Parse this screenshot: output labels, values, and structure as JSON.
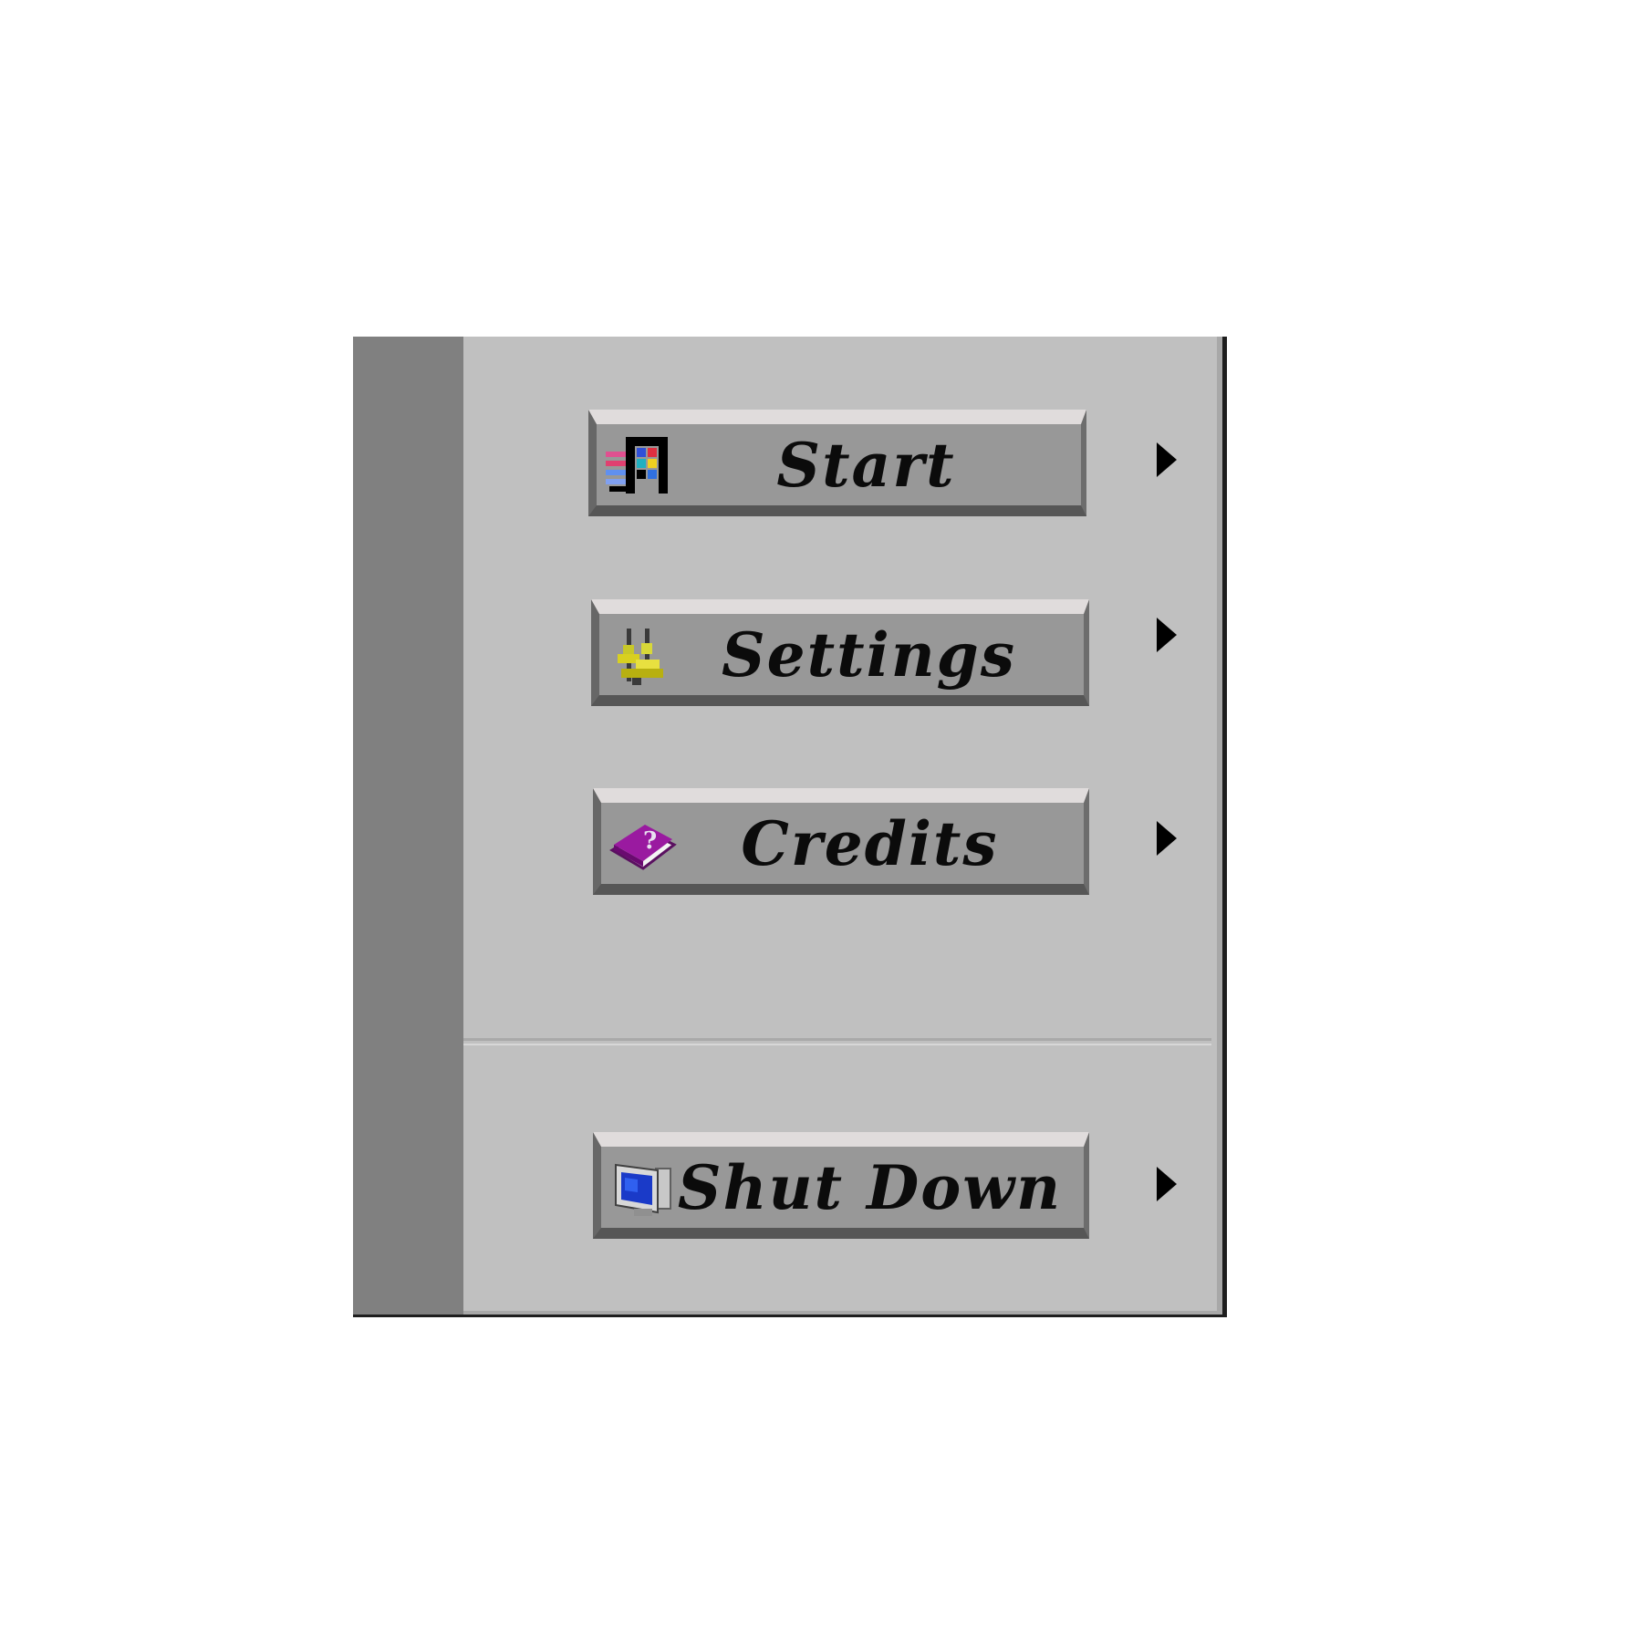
{
  "menu": {
    "items": [
      {
        "label": "Start",
        "icon": "app-grid-icon",
        "submenu": true
      },
      {
        "label": "Settings",
        "icon": "tools-icon",
        "submenu": true
      },
      {
        "label": "Credits",
        "icon": "help-book-icon",
        "submenu": true
      },
      {
        "label": "Shut Down",
        "icon": "monitor-icon",
        "submenu": true
      }
    ]
  },
  "colors": {
    "panel": "#c0c0c0",
    "side_strip": "#808080",
    "button_face": "#989898",
    "button_highlight": "#e0dcdc",
    "button_shadow": "#565656",
    "text": "#0b0b0b"
  }
}
